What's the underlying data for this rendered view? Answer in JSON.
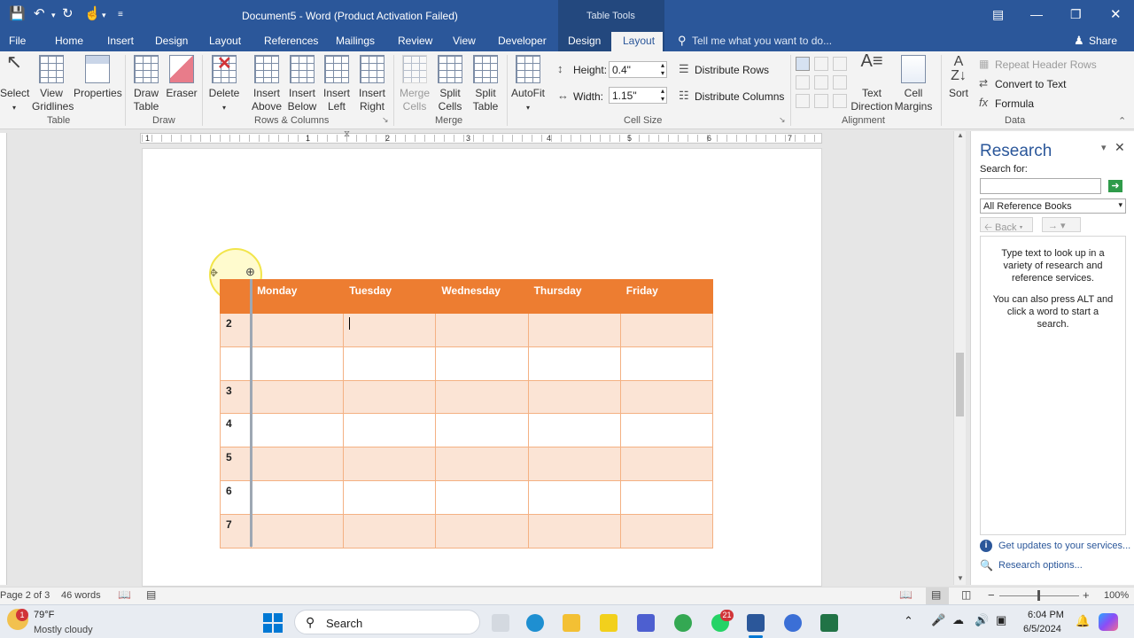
{
  "title": "Document5 - Word (Product Activation Failed)",
  "context_tab": "Table Tools",
  "tabs": [
    "File",
    "Home",
    "Insert",
    "Design",
    "Layout",
    "References",
    "Mailings",
    "Review",
    "View",
    "Developer",
    "Design",
    "Layout"
  ],
  "tell_me": "Tell me what you want to do...",
  "share": "Share",
  "ribbon": {
    "select": "Select",
    "view_gridlines": [
      "View",
      "Gridlines"
    ],
    "properties": "Properties",
    "draw_table": [
      "Draw",
      "Table"
    ],
    "eraser": "Eraser",
    "delete": "Delete",
    "insert_above": [
      "Insert",
      "Above"
    ],
    "insert_below": [
      "Insert",
      "Below"
    ],
    "insert_left": [
      "Insert",
      "Left"
    ],
    "insert_right": [
      "Insert",
      "Right"
    ],
    "merge_cells": [
      "Merge",
      "Cells"
    ],
    "split_cells": [
      "Split",
      "Cells"
    ],
    "split_table": [
      "Split",
      "Table"
    ],
    "autofit": "AutoFit",
    "height_label": "Height:",
    "height_value": "0.4\"",
    "width_label": "Width:",
    "width_value": "1.15\"",
    "distribute_rows": "Distribute Rows",
    "distribute_columns": "Distribute Columns",
    "text_direction": [
      "Text",
      "Direction"
    ],
    "cell_margins": [
      "Cell",
      "Margins"
    ],
    "sort": "Sort",
    "repeat_header_rows": "Repeat Header Rows",
    "convert_to_text": "Convert to Text",
    "formula": "Formula",
    "groups": {
      "table": "Table",
      "draw": "Draw",
      "rows_columns": "Rows & Columns",
      "merge": "Merge",
      "cell_size": "Cell Size",
      "alignment": "Alignment",
      "data": "Data"
    }
  },
  "ruler_numbers": [
    "1",
    "1",
    "2",
    "3",
    "4",
    "5",
    "6",
    "7"
  ],
  "table": {
    "header": [
      "",
      "Monday",
      "Tuesday",
      "Wednesday",
      "Thursday",
      "Friday"
    ],
    "row_labels": [
      "2",
      "",
      "3",
      "4",
      "5",
      "6",
      "7"
    ]
  },
  "research": {
    "title": "Research",
    "search_for": "Search for:",
    "search_value": "",
    "source": "All Reference Books",
    "back": "Back",
    "help1": "Type text to look up in a variety of research and reference services.",
    "help2": "You can also press ALT and click a word to start a search.",
    "get_updates": "Get updates to your services...",
    "research_options": "Research options..."
  },
  "status": {
    "page": "Page 2 of 3",
    "words": "46 words",
    "zoom": "100%"
  },
  "taskbar": {
    "temp": "79°F",
    "weather": "Mostly cloudy",
    "weather_badge": "1",
    "search": "Search",
    "whatsapp_badge": "21",
    "time": "6:04 PM",
    "date": "6/5/2024"
  }
}
